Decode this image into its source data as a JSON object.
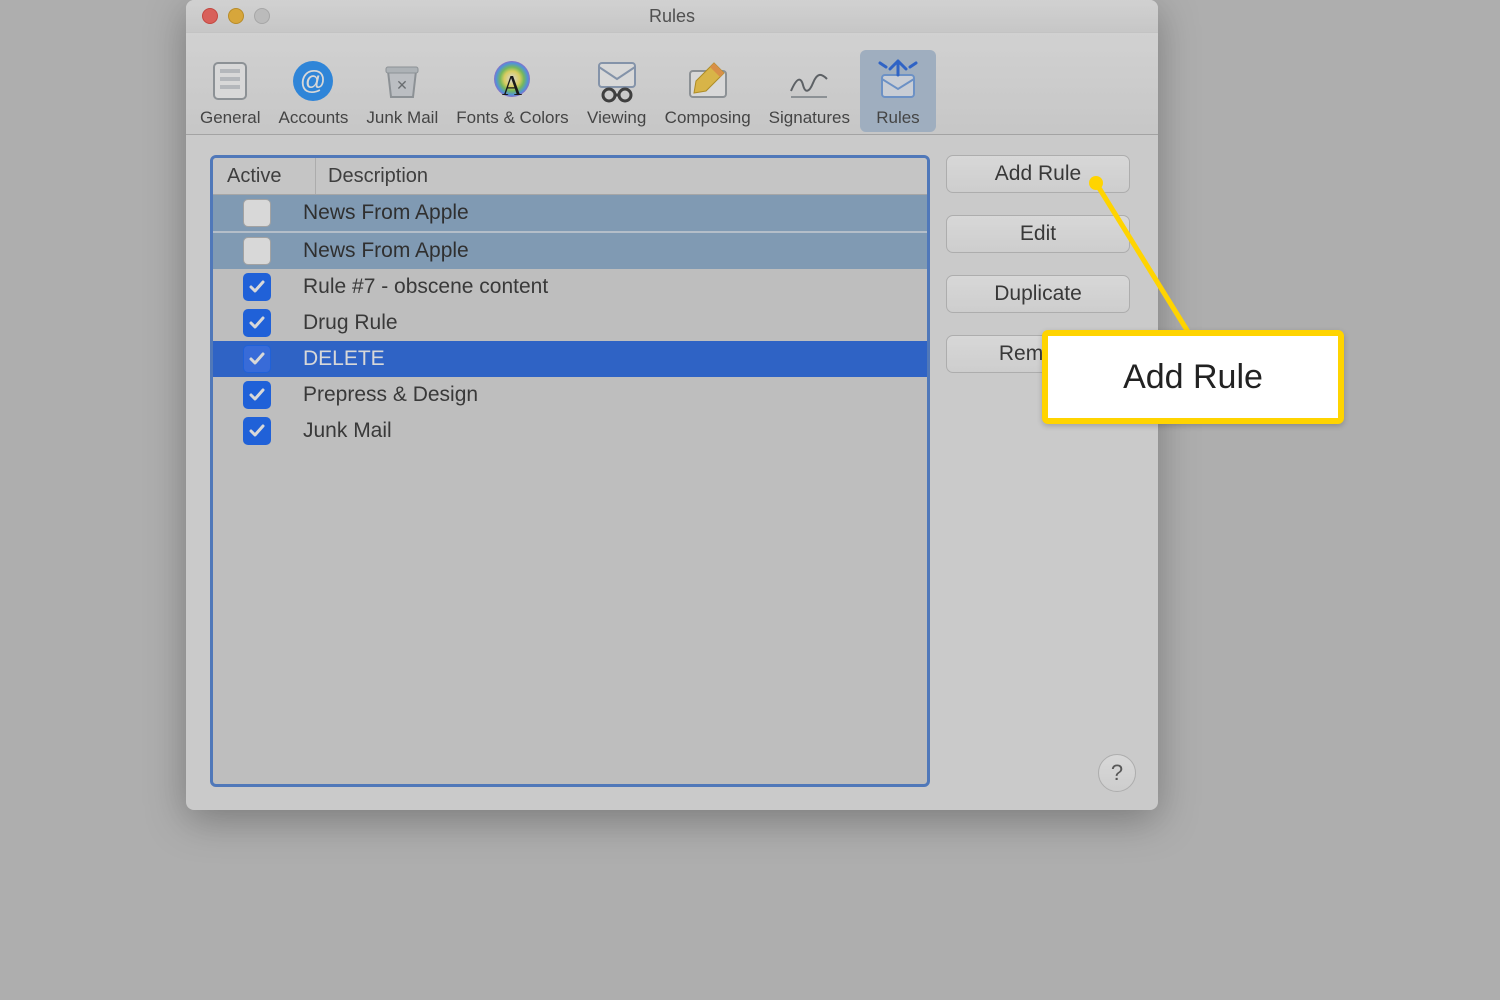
{
  "window": {
    "title": "Rules"
  },
  "toolbar": {
    "tabs": [
      {
        "id": "general",
        "label": "General"
      },
      {
        "id": "accounts",
        "label": "Accounts"
      },
      {
        "id": "junk",
        "label": "Junk Mail"
      },
      {
        "id": "fonts",
        "label": "Fonts & Colors"
      },
      {
        "id": "viewing",
        "label": "Viewing"
      },
      {
        "id": "composing",
        "label": "Composing"
      },
      {
        "id": "signatures",
        "label": "Signatures"
      },
      {
        "id": "rules",
        "label": "Rules",
        "selected": true
      }
    ]
  },
  "columns": {
    "active": "Active",
    "description": "Description"
  },
  "rules": [
    {
      "active": false,
      "description": "News From Apple",
      "state": "soft"
    },
    {
      "active": false,
      "description": "News From Apple",
      "state": "soft"
    },
    {
      "active": true,
      "description": "Rule #7 - obscene content",
      "state": ""
    },
    {
      "active": true,
      "description": "Drug Rule",
      "state": ""
    },
    {
      "active": true,
      "description": "DELETE",
      "state": "sel"
    },
    {
      "active": true,
      "description": "Prepress & Design",
      "state": ""
    },
    {
      "active": true,
      "description": "Junk Mail",
      "state": ""
    }
  ],
  "buttons": {
    "add": "Add Rule",
    "edit": "Edit",
    "duplicate": "Duplicate",
    "remove": "Remove"
  },
  "help": "?",
  "callout": {
    "label": "Add Rule"
  }
}
